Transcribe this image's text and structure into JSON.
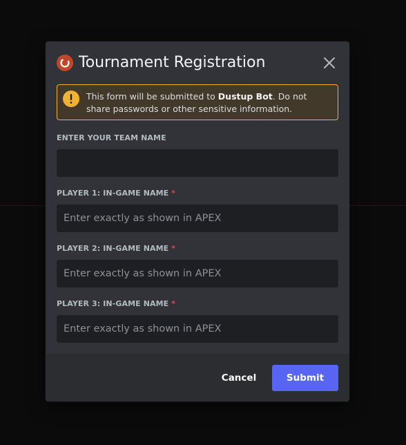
{
  "modal": {
    "title": "Tournament Registration",
    "close_icon": "close-icon",
    "bot_icon": "bot-avatar-icon"
  },
  "warning": {
    "icon": "exclamation-icon",
    "text_before": "This form will be submitted to ",
    "bot_name": "Dustup Bot",
    "text_after": ". Do not share passwords or other sensitive information."
  },
  "fields": [
    {
      "label": "ENTER YOUR TEAM NAME",
      "required": false,
      "placeholder": "",
      "value": ""
    },
    {
      "label": "PLAYER 1: IN-GAME NAME",
      "required": true,
      "placeholder": "Enter exactly as shown in APEX",
      "value": ""
    },
    {
      "label": "PLAYER 2: IN-GAME NAME",
      "required": true,
      "placeholder": "Enter exactly as shown in APEX",
      "value": ""
    },
    {
      "label": "PLAYER 3: IN-GAME NAME",
      "required": true,
      "placeholder": "Enter exactly as shown in APEX",
      "value": ""
    }
  ],
  "required_marker": "*",
  "footer": {
    "cancel_label": "Cancel",
    "submit_label": "Submit"
  },
  "colors": {
    "accent": "#5865f2",
    "warning": "#f0b232",
    "required": "#f23f43",
    "bot_avatar": "#c0472a"
  }
}
